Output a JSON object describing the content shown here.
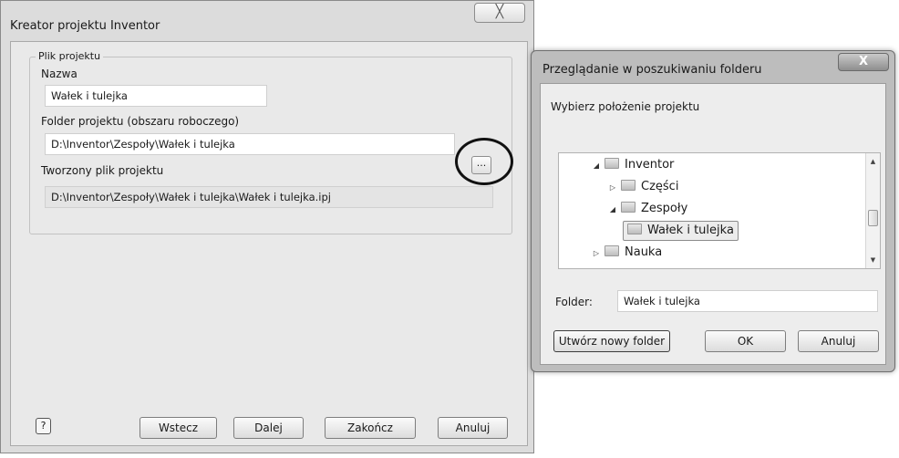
{
  "dialog1": {
    "title": "Kreator projektu Inventor",
    "close_label": "╳",
    "group_label": "Plik projektu",
    "name_label": "Nazwa",
    "name_value": "Wałek i tulejka",
    "folder_label": "Folder projektu (obszaru roboczego)",
    "folder_value": "D:\\Inventor\\Zespoły\\Wałek i tulejka",
    "browse_label": "...",
    "file_label": "Tworzony plik projektu",
    "file_value": "D:\\Inventor\\Zespoły\\Wałek i tulejka\\Wałek i tulejka.ipj",
    "help_label": "?",
    "buttons": {
      "back": "Wstecz",
      "next": "Dalej",
      "finish": "Zakończ",
      "cancel": "Anuluj"
    }
  },
  "dialog2": {
    "title": "Przeglądanie w poszukiwaniu folderu",
    "close_label": "X",
    "instruction": "Wybierz położenie projektu",
    "tree": [
      {
        "label": "Inventor",
        "expander": "◢"
      },
      {
        "label": "Części",
        "expander": "▷"
      },
      {
        "label": "Zespoły",
        "expander": "◢"
      },
      {
        "label": "Wałek i tulejka",
        "expander": "",
        "selected": true
      },
      {
        "label": "Nauka",
        "expander": "▷"
      }
    ],
    "folder_label": "Folder:",
    "folder_value": "Wałek i tulejka",
    "buttons": {
      "new_folder": "Utwórz nowy folder",
      "ok": "OK",
      "cancel": "Anuluj"
    }
  },
  "icons": {
    "folder": "folder-icon",
    "help": "help-icon",
    "close": "close-icon"
  }
}
